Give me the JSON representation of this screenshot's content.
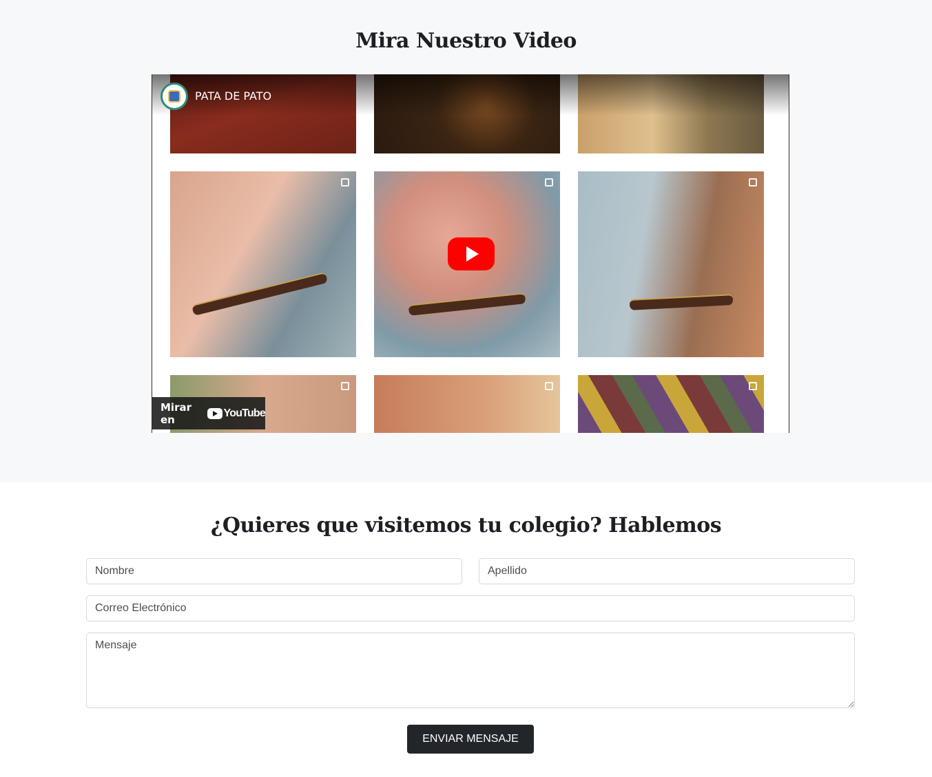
{
  "video_section": {
    "title": "Mira Nuestro Video",
    "player": {
      "channel_name": "PATA DE PATO",
      "play_icon": "play-icon",
      "watch_on_label": "Mirar en",
      "youtube_logo_text": "YouTube"
    }
  },
  "contact_section": {
    "title": "¿Quieres que visitemos tu colegio? Hablemos",
    "form": {
      "first_name_placeholder": "Nombre",
      "last_name_placeholder": "Apellido",
      "email_placeholder": "Correo Electrónico",
      "message_placeholder": "Mensaje",
      "submit_label": "ENVIAR MENSAJE"
    }
  },
  "colors": {
    "section_bg": "#f7f8f9",
    "button_bg": "#22262b",
    "youtube_red": "#ff0000"
  }
}
